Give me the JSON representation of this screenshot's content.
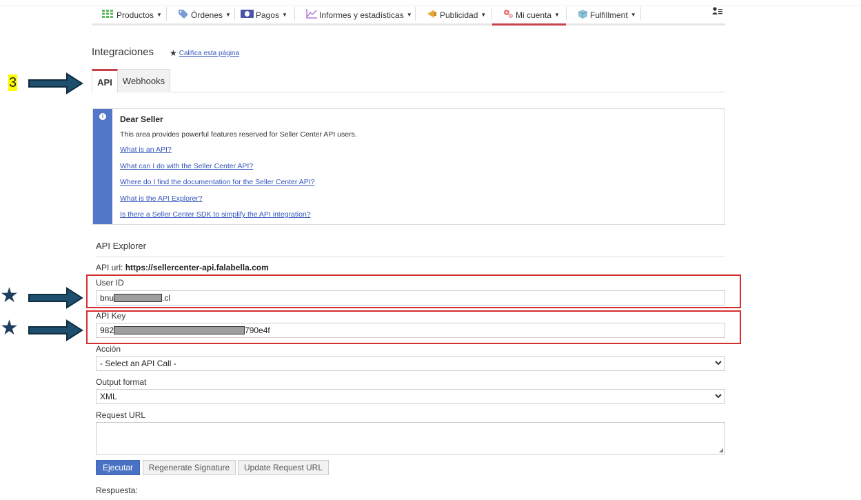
{
  "nav": {
    "items": [
      {
        "label": "Productos",
        "icon": "grid-icon"
      },
      {
        "label": "Órdenes",
        "icon": "tag-icon"
      },
      {
        "label": "Pagos",
        "icon": "money-icon"
      },
      {
        "label": "Informes y estadísticas",
        "icon": "chart-icon"
      },
      {
        "label": "Publicidad",
        "icon": "megaphone-icon"
      },
      {
        "label": "Mi cuenta",
        "icon": "gears-icon"
      },
      {
        "label": "Fulfillment",
        "icon": "box-icon"
      }
    ],
    "active": "Mi cuenta"
  },
  "page": {
    "title": "Integraciones",
    "rate_link": "Califica esta página"
  },
  "tabs": [
    {
      "label": "API",
      "active": true
    },
    {
      "label": "Webhooks",
      "active": false
    }
  ],
  "annotations": {
    "step_number": "3"
  },
  "info": {
    "title": "Dear Seller",
    "text": "This area provides powerful features reserved for Seller Center API users.",
    "links": [
      "What is an API?",
      "What can I do with the Seller Center API?",
      "Where do I find the documentation for the Seller Center API?",
      "What is the API Explorer?",
      "Is there a Seller Center SDK to simplify the API integration?"
    ]
  },
  "explorer": {
    "title": "API Explorer",
    "api_url_label": "API url:",
    "api_url": "https://sellercenter-api.falabella.com",
    "user_id_label": "User ID",
    "user_id_prefix": "bnu",
    "user_id_suffix": ".cl",
    "api_key_label": "API Key",
    "api_key_prefix": "982",
    "api_key_suffix": "790e4f",
    "action_label": "Acción",
    "action_value": "- Select an API Call -",
    "output_label": "Output format",
    "output_value": "XML",
    "request_url_label": "Request URL",
    "request_url_value": "",
    "btn_execute": "Ejecutar",
    "btn_regenerate": "Regenerate Signature",
    "btn_update": "Update Request URL",
    "response_label": "Respuesta:"
  },
  "colors": {
    "accent_red": "#c6414a",
    "info_blue": "#5277c9",
    "primary_button": "#4a72c4",
    "arrow_navy": "#1d3e5c",
    "highlight_box": "#d32f2f"
  }
}
